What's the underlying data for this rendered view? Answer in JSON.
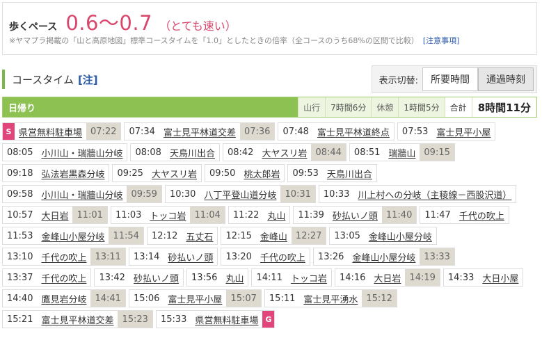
{
  "pace": {
    "label": "歩くペース",
    "value": "0.6〜0.7",
    "desc": "（とても速い）",
    "note": "※ヤマプラ掲載の「山と高原地図」標準コースタイムを「1.0」としたときの倍率（全コースのうち68%の区間で比較）",
    "note_link": "[注意事項]"
  },
  "section": {
    "title": "コースタイム",
    "note_link": "[注]",
    "toggle_label": "表示切替:",
    "toggle_options": [
      "所要時間",
      "通過時刻"
    ],
    "toggle_active": "通過時刻"
  },
  "summary": {
    "title": "日帰り",
    "moving_label": "山行",
    "moving_value": "7時間6分",
    "rest_label": "休憩",
    "rest_value": "1時間5分",
    "total_label": "合計",
    "total_value": "8時間11分"
  },
  "colors": {
    "accent_green": "#8dc152",
    "pace_pink": "#d9466b",
    "badge_pink": "#e0467c"
  },
  "route": [
    {
      "badge": "S",
      "name": "県営無料駐車場",
      "dep": "07:22"
    },
    {
      "arr": "07:34",
      "name": "富士見平林道交差",
      "dep": "07:36"
    },
    {
      "arr": "07:48",
      "name": "富士見平林道終点"
    },
    {
      "arr": "07:53",
      "name": "富士見平小屋"
    },
    {
      "arr": "08:05",
      "name": "小川山・瑞牆山分岐"
    },
    {
      "arr": "08:08",
      "name": "天鳥川出合"
    },
    {
      "arr": "08:42",
      "name": "大ヤスリ岩",
      "dep": "08:44"
    },
    {
      "arr": "08:51",
      "name": "瑞牆山",
      "dep": "09:15"
    },
    {
      "arr": "09:18",
      "name": "弘法岩黒森分岐"
    },
    {
      "arr": "09:25",
      "name": "大ヤスリ岩"
    },
    {
      "arr": "09:50",
      "name": "桃太郎岩"
    },
    {
      "arr": "09:53",
      "name": "天鳥川出合"
    },
    {
      "arr": "09:58",
      "name": "小川山・瑞牆山分岐",
      "dep": "09:59"
    },
    {
      "arr": "10:30",
      "name": "八丁平登山道分岐",
      "dep": "10:31"
    },
    {
      "arr": "10:33",
      "name": "川上村への分岐（主稜線－西股沢道）"
    },
    {
      "arr": "10:57",
      "name": "大日岩",
      "dep": "11:01"
    },
    {
      "arr": "11:03",
      "name": "トッコ岩",
      "dep": "11:04"
    },
    {
      "arr": "11:22",
      "name": "丸山"
    },
    {
      "arr": "11:39",
      "name": "砂払いノ頭",
      "dep": "11:40"
    },
    {
      "arr": "11:47",
      "name": "千代の吹上"
    },
    {
      "arr": "11:53",
      "name": "金峰山小屋分岐",
      "dep": "11:54"
    },
    {
      "arr": "12:12",
      "name": "五丈石"
    },
    {
      "arr": "12:15",
      "name": "金峰山",
      "dep": "12:27"
    },
    {
      "arr": "13:05",
      "name": "金峰山小屋分岐"
    },
    {
      "arr": "13:10",
      "name": "千代の吹上",
      "dep": "13:11"
    },
    {
      "arr": "13:14",
      "name": "砂払いノ頭"
    },
    {
      "arr": "13:20",
      "name": "千代の吹上"
    },
    {
      "arr": "13:26",
      "name": "金峰山小屋分岐",
      "dep": "13:33"
    },
    {
      "arr": "13:37",
      "name": "千代の吹上"
    },
    {
      "arr": "13:42",
      "name": "砂払いノ頭"
    },
    {
      "arr": "13:56",
      "name": "丸山"
    },
    {
      "arr": "14:11",
      "name": "トッコ岩"
    },
    {
      "arr": "14:16",
      "name": "大日岩",
      "dep": "14:19"
    },
    {
      "arr": "14:33",
      "name": "大日小屋"
    },
    {
      "arr": "14:40",
      "name": "鷹見岩分岐",
      "dep": "14:41"
    },
    {
      "arr": "15:06",
      "name": "富士見平小屋",
      "dep": "15:07"
    },
    {
      "arr": "15:11",
      "name": "富士見平湧水",
      "dep": "15:12"
    },
    {
      "arr": "15:21",
      "name": "富士見平林道交差",
      "dep": "15:23"
    },
    {
      "arr": "15:33",
      "name": "県営無料駐車場",
      "badge_end": "G"
    }
  ]
}
